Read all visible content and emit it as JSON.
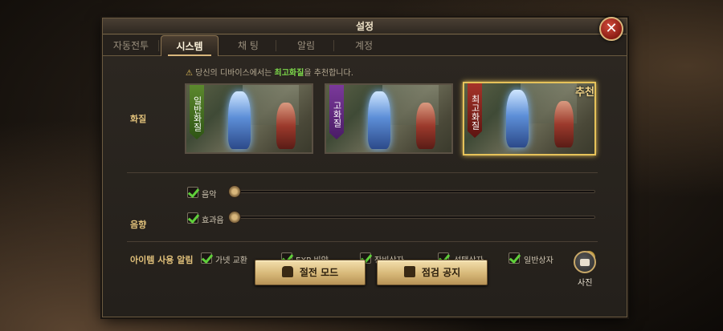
{
  "window": {
    "title": "설정",
    "close_label": "✕"
  },
  "tabs": [
    {
      "label": "자동전투",
      "active": false
    },
    {
      "label": "시스템",
      "active": true
    },
    {
      "label": "채 팅",
      "active": false
    },
    {
      "label": "알림",
      "active": false
    },
    {
      "label": "계정",
      "active": false
    }
  ],
  "graphics": {
    "section_label": "화질",
    "notice_prefix": "당신의 디바이스에서는 ",
    "notice_highlight": "최고화질",
    "notice_suffix": "을 추천합니다.",
    "notice_icon": "warning-icon",
    "options": [
      {
        "label": "일반화질",
        "ribbon_color": "#5d8a2e",
        "selected": false
      },
      {
        "label": "고화질",
        "ribbon_color": "#7c3a9c",
        "selected": false
      },
      {
        "label": "최고화질",
        "ribbon_color": "#a8342a",
        "selected": true,
        "badge": "추천"
      }
    ]
  },
  "sound": {
    "section_label": "음향",
    "music": {
      "label": "음악",
      "checked": true,
      "level": 0
    },
    "effects": {
      "label": "효과음",
      "checked": true,
      "level": 0
    }
  },
  "item_alerts": {
    "section_label": "아이템 사용 알림",
    "options": [
      {
        "label": "가넷 교환",
        "checked": true
      },
      {
        "label": "EXP 비약",
        "checked": true
      },
      {
        "label": "장비상자",
        "checked": true
      },
      {
        "label": "선택상자",
        "checked": true
      },
      {
        "label": "일반상자",
        "checked": true
      }
    ],
    "info_icon": "!"
  },
  "buttons": {
    "power_save": "절전 모드",
    "maintenance": "점검 공지"
  },
  "camera": {
    "label": "사진"
  },
  "colors": {
    "accent_gold": "#d9b77c",
    "check_green": "#5fcf3a",
    "highlight_green": "#7cd64a"
  }
}
